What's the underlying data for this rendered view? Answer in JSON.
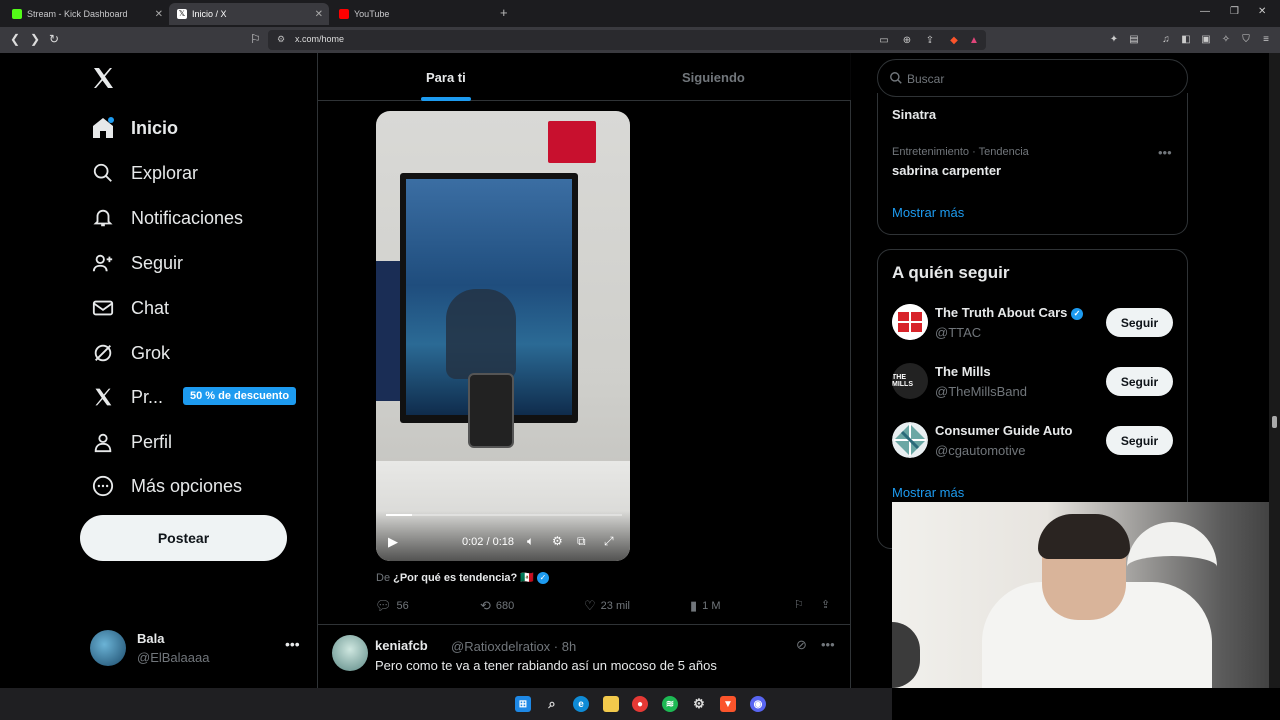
{
  "browser": {
    "tabs": [
      {
        "title": "Stream - Kick Dashboard",
        "favicon_color": "#53fc18"
      },
      {
        "title": "Inicio / X",
        "favicon_color": "#ffffff"
      },
      {
        "title": "YouTube",
        "favicon_color": "#ff0000"
      }
    ],
    "url": "x.com/home"
  },
  "nav": {
    "items": [
      {
        "label": "Inicio",
        "icon": "home-icon"
      },
      {
        "label": "Explorar",
        "icon": "search-icon"
      },
      {
        "label": "Notificaciones",
        "icon": "bell-icon"
      },
      {
        "label": "Seguir",
        "icon": "add-user-icon"
      },
      {
        "label": "Chat",
        "icon": "mail-icon"
      },
      {
        "label": "Grok",
        "icon": "grok-icon"
      },
      {
        "label": "Pr...",
        "icon": "x-logo-icon"
      },
      {
        "label": "Perfil",
        "icon": "user-icon"
      },
      {
        "label": "Más opciones",
        "icon": "more-circle-icon"
      }
    ],
    "promo_badge": "50 % de descuento",
    "post_button": "Postear",
    "profile": {
      "name": "Bala",
      "handle": "@ElBalaaaa"
    }
  },
  "feed": {
    "tabs": [
      "Para ti",
      "Siguiendo"
    ],
    "active_tab": "Para ti",
    "video": {
      "time": "0:02 / 0:18",
      "progress": 0.11
    },
    "source": {
      "prefix": "De",
      "name": "¿Por qué es tendencia? 🇲🇽"
    },
    "actions": {
      "replies": "56",
      "reposts": "680",
      "likes": "23 mil",
      "views": "1 M"
    },
    "next_tweet": {
      "name": "keniafcb",
      "handle_time": "@Ratioxdelratiox · 8h",
      "text": "Pero como te va a tener rabiando así un mocoso de 5 años"
    }
  },
  "sidebar": {
    "search_placeholder": "Buscar",
    "trends": {
      "partial_trend": "Sinatra",
      "trend_category": "Entretenimiento · Tendencia",
      "trend_name": "sabrina carpenter",
      "show_more": "Mostrar más"
    },
    "who_to_follow": {
      "title": "A quién seguir",
      "accounts": [
        {
          "name": "The Truth About Cars",
          "handle": "@TTAC",
          "verified": true,
          "button": "Seguir"
        },
        {
          "name": "The Mills",
          "handle": "@TheMillsBand",
          "verified": false,
          "button": "Seguir"
        },
        {
          "name": "Consumer Guide Auto",
          "handle": "@cgautomotive",
          "verified": false,
          "button": "Seguir"
        }
      ],
      "show_more": "Mostrar más"
    }
  },
  "colors": {
    "accent": "#1d9bf0",
    "background": "#000000",
    "muted": "#71767b"
  }
}
